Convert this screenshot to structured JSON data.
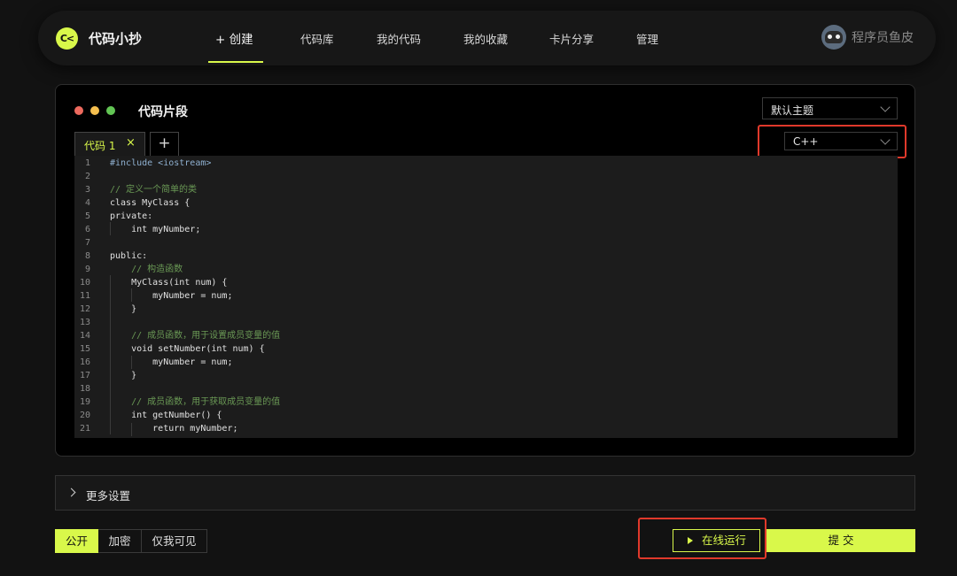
{
  "app": {
    "logo_mark": "C<",
    "logo_text": "代码小抄"
  },
  "nav": {
    "items": [
      {
        "label": "+ 创建",
        "active": true
      },
      {
        "label": "代码库"
      },
      {
        "label": "我的代码"
      },
      {
        "label": "我的收藏"
      },
      {
        "label": "卡片分享"
      },
      {
        "label": "管理"
      }
    ]
  },
  "user": {
    "name": "程序员鱼皮",
    "avatar": "avatar-icon"
  },
  "editor": {
    "title": "代码片段",
    "window_dots": [
      "#ed6a5e",
      "#f5bf4f",
      "#62c554"
    ],
    "theme_select": {
      "value": "默认主题"
    },
    "language_select": {
      "value": "C++"
    },
    "tabs": [
      {
        "label": "代码 1",
        "close": "×"
      }
    ],
    "add_tab": "+",
    "code_lines": [
      {
        "n": "1",
        "text": "#include <iostream>"
      },
      {
        "n": "2",
        "text": ""
      },
      {
        "n": "3",
        "text": "// 定义一个简单的类"
      },
      {
        "n": "4",
        "text": "class MyClass {"
      },
      {
        "n": "5",
        "text": "private:"
      },
      {
        "n": "6",
        "text": "    int myNumber;"
      },
      {
        "n": "7",
        "text": ""
      },
      {
        "n": "8",
        "text": "public:"
      },
      {
        "n": "9",
        "text": "    // 构造函数"
      },
      {
        "n": "10",
        "text": "    MyClass(int num) {"
      },
      {
        "n": "11",
        "text": "        myNumber = num;"
      },
      {
        "n": "12",
        "text": "    }"
      },
      {
        "n": "13",
        "text": ""
      },
      {
        "n": "14",
        "text": "    // 成员函数，用于设置成员变量的值"
      },
      {
        "n": "15",
        "text": "    void setNumber(int num) {"
      },
      {
        "n": "16",
        "text": "        myNumber = num;"
      },
      {
        "n": "17",
        "text": "    }"
      },
      {
        "n": "18",
        "text": ""
      },
      {
        "n": "19",
        "text": "    // 成员函数，用于获取成员变量的值"
      },
      {
        "n": "20",
        "text": "    int getNumber() {"
      },
      {
        "n": "21",
        "text": "        return myNumber;"
      }
    ]
  },
  "settings": {
    "label": "更多设置"
  },
  "visibility": {
    "options": [
      "公开",
      "加密",
      "仅我可见"
    ],
    "selected": "公开"
  },
  "actions": {
    "run_label": "在线运行",
    "submit_label": "提 交"
  },
  "colors": {
    "accent": "#d9f84a",
    "highlight": "#e0392b"
  }
}
